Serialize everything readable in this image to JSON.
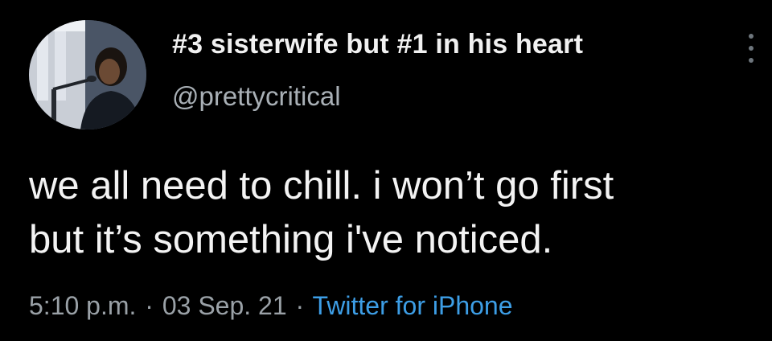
{
  "tweet": {
    "display_name": "#3 sisterwife but #1 in his heart",
    "handle": "@prettycritical",
    "text_lines": [
      "we all need to chill. i won’t go first",
      "but it’s something i've noticed."
    ],
    "time": "5:10 p.m.",
    "date": "03 Sep. 21",
    "source": "Twitter for iPhone",
    "separator": "·"
  },
  "icons": {
    "avatar": "avatar-photo",
    "more": "more-vertical-icon"
  },
  "colors": {
    "background": "#000000",
    "primary_text": "#f3f3f3",
    "secondary_text": "#9aa1a7",
    "link": "#3d9ee6"
  }
}
